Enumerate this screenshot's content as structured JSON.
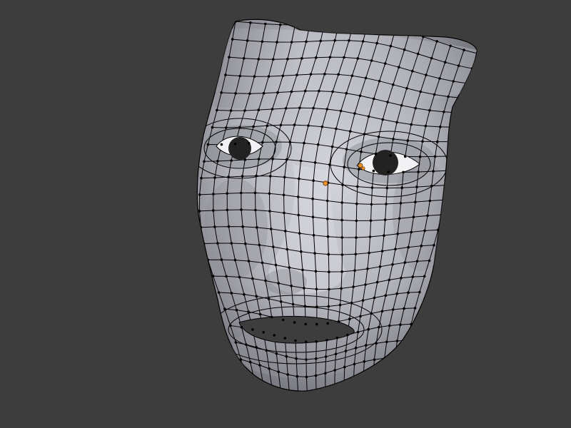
{
  "viewport": {
    "background": "#3d3d3d",
    "mesh_fill": "#b4b5bd",
    "wire_color": "#000000",
    "vertex_color": "#000000",
    "selected_vertex_color": "#f2902a",
    "eye_color": "#222222"
  },
  "object": {
    "icon": "face-mesh-icon",
    "selected_vertex_count": 3
  }
}
